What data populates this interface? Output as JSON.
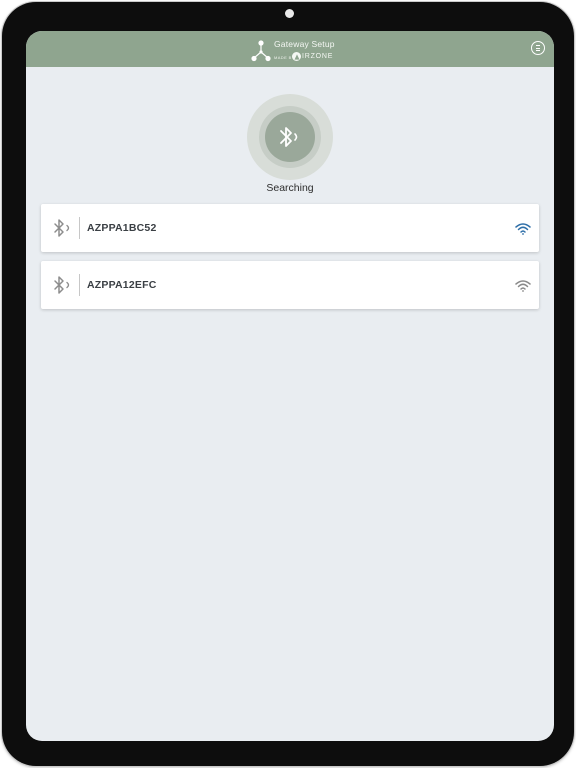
{
  "header": {
    "title": "Gateway Setup",
    "made_by": "MADE BY",
    "brand": "IRZONE",
    "brand_badge_letter": "A",
    "logo_icon": "network-nodes-icon",
    "menu_icon": "menu-circle-icon"
  },
  "scan": {
    "icon": "bluetooth-signal-icon",
    "status": "Searching"
  },
  "devices": [
    {
      "name": "AZPPA1BC52",
      "icon": "bluetooth-signal-icon",
      "signal_icon": "wifi-icon",
      "signal_color": "#2f6fa8"
    },
    {
      "name": "AZPPA12EFC",
      "icon": "bluetooth-signal-icon",
      "signal_icon": "wifi-icon",
      "signal_color": "#8a8a8a"
    }
  ],
  "colors": {
    "header_bg": "#8fa58f",
    "screen_bg": "#e9edf1",
    "bezel": "#0d0d0d",
    "card_bg": "#ffffff",
    "text_dark": "#3a3f44"
  }
}
